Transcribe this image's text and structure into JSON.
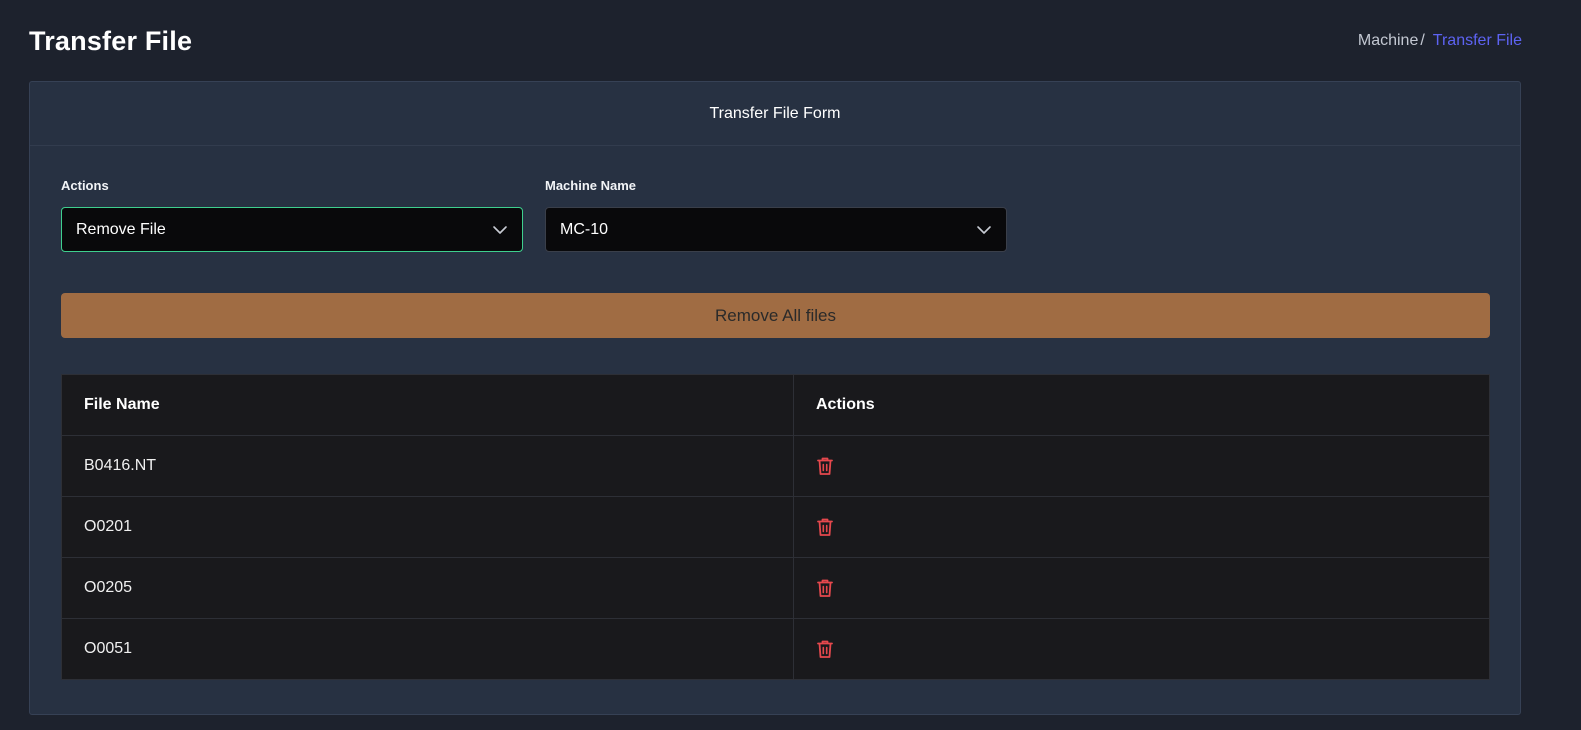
{
  "page": {
    "title": "Transfer File"
  },
  "breadcrumb": {
    "parent": "Machine",
    "separator": "/",
    "current": "Transfer File"
  },
  "card": {
    "title": "Transfer File Form"
  },
  "form": {
    "actions": {
      "label": "Actions",
      "value": "Remove File"
    },
    "machine": {
      "label": "Machine Name",
      "value": "MC-10"
    }
  },
  "remove_all_button": {
    "label": "Remove All files",
    "color": "#a06c43"
  },
  "table": {
    "headers": [
      "File Name",
      "Actions"
    ],
    "rows": [
      {
        "file_name": "B0416.NT",
        "action_icon": "trash-icon"
      },
      {
        "file_name": "O0201",
        "action_icon": "trash-icon"
      },
      {
        "file_name": "O0205",
        "action_icon": "trash-icon"
      },
      {
        "file_name": "O0051",
        "action_icon": "trash-icon"
      }
    ]
  },
  "colors": {
    "accent": "#5d63f2",
    "focus_border": "#3ecf8e",
    "danger": "#e5484d"
  }
}
